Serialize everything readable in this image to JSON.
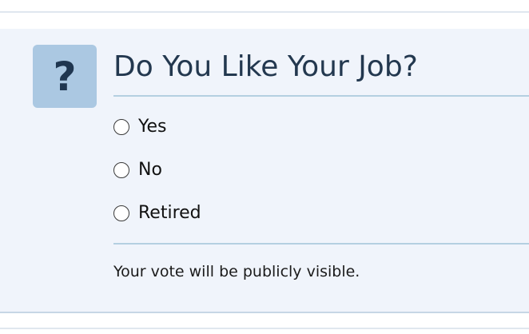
{
  "poll": {
    "badge_icon": "question-mark-icon",
    "badge_glyph": "?",
    "title": "Do You Like Your Job?",
    "options": [
      {
        "label": "Yes",
        "selected": false
      },
      {
        "label": "No",
        "selected": false
      },
      {
        "label": "Retired",
        "selected": false
      }
    ],
    "visibility_note": "Your vote will be publicly visible."
  },
  "colors": {
    "panel_background": "#f0f4fb",
    "badge_background": "#abc8e2",
    "badge_glyph": "#1f3650",
    "title_text": "#23384f",
    "rule": "#b4cfe1"
  }
}
